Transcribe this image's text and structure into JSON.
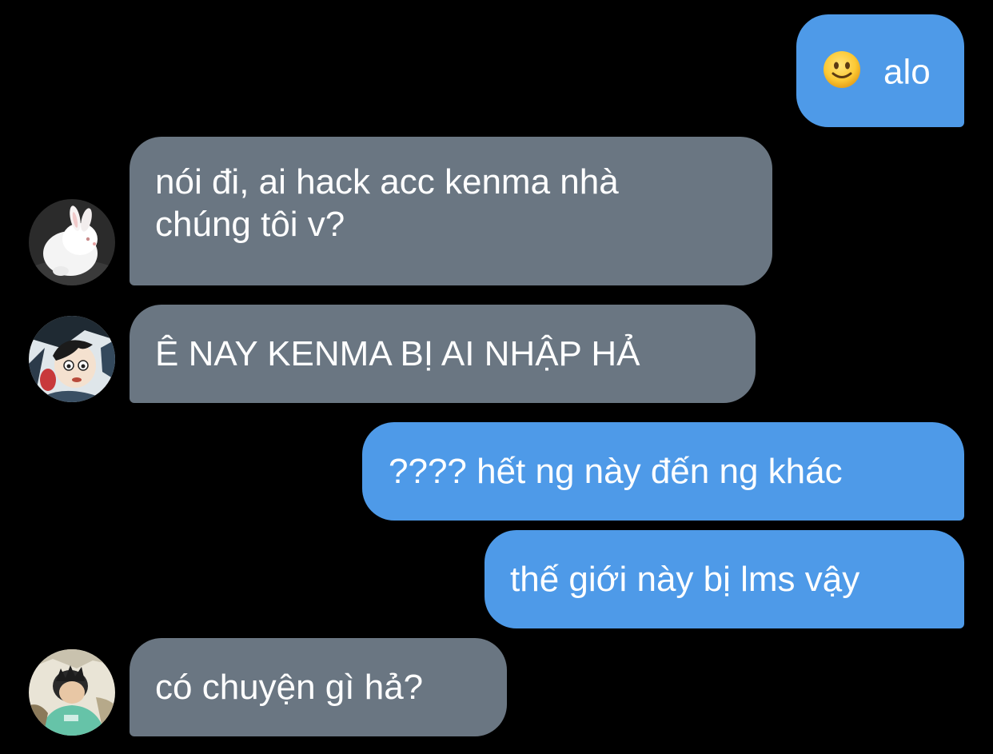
{
  "conversation": {
    "messages": [
      {
        "sender": "me",
        "emoji": "slightly-smiling-face-icon",
        "text": "alo"
      },
      {
        "sender": "rabbit-avatar",
        "line1": "nói đi, ai hack acc kenma nhà",
        "line2": "chúng tôi v?"
      },
      {
        "sender": "anime-avatar-1",
        "text": "Ê NAY KENMA BỊ AI NHẬP HẢ"
      },
      {
        "sender": "me",
        "text": "???? hết ng này đến ng khác"
      },
      {
        "sender": "me",
        "text": "thế giới này bị lms vậy"
      },
      {
        "sender": "anime-avatar-2",
        "text": "có chuyện gì hả?"
      }
    ]
  },
  "colors": {
    "background": "#000000",
    "outgoing_bubble": "#4e9ae8",
    "incoming_bubble": "#6a7682",
    "text": "#ffffff"
  }
}
